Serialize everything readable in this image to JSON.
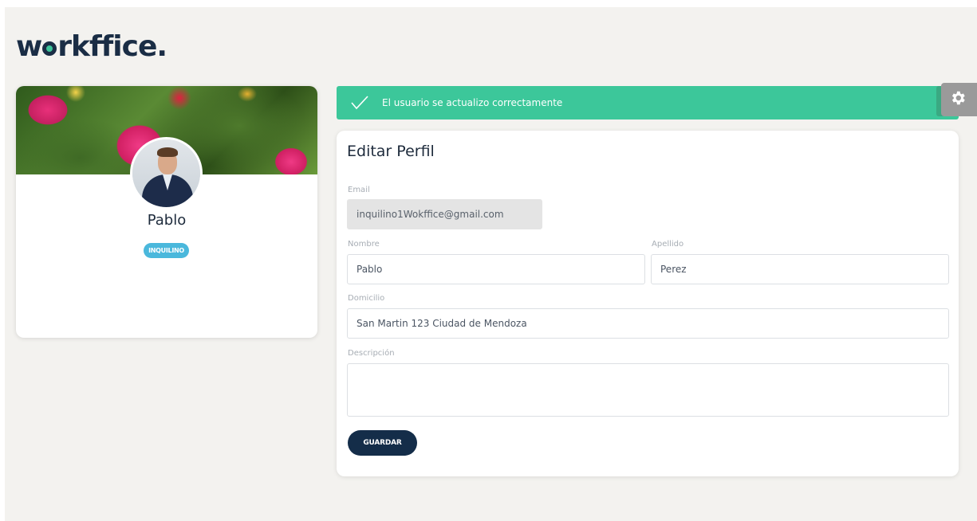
{
  "brand": {
    "logo_prefix": "w",
    "logo_suffix": "rkffice."
  },
  "profile": {
    "name": "Pablo",
    "role": "INQUILINO"
  },
  "alert": {
    "message": "El usuario se actualizo correctamente",
    "close_symbol": "×"
  },
  "form": {
    "title": "Editar Perfil",
    "email": {
      "label": "Email",
      "value": "inquilino1Wokffice@gmail.com"
    },
    "nombre": {
      "label": "Nombre",
      "value": "Pablo"
    },
    "apellido": {
      "label": "Apellido",
      "value": "Perez"
    },
    "domicilio": {
      "label": "Domicilio",
      "value": "San Martin 123 Ciudad de Mendoza"
    },
    "descripcion": {
      "label": "Descripción",
      "value": ""
    },
    "save_label": "GUARDAR"
  },
  "colors": {
    "alert_bg": "#3cc79a",
    "brand_dark": "#142d49",
    "badge": "#4ab8dc"
  }
}
